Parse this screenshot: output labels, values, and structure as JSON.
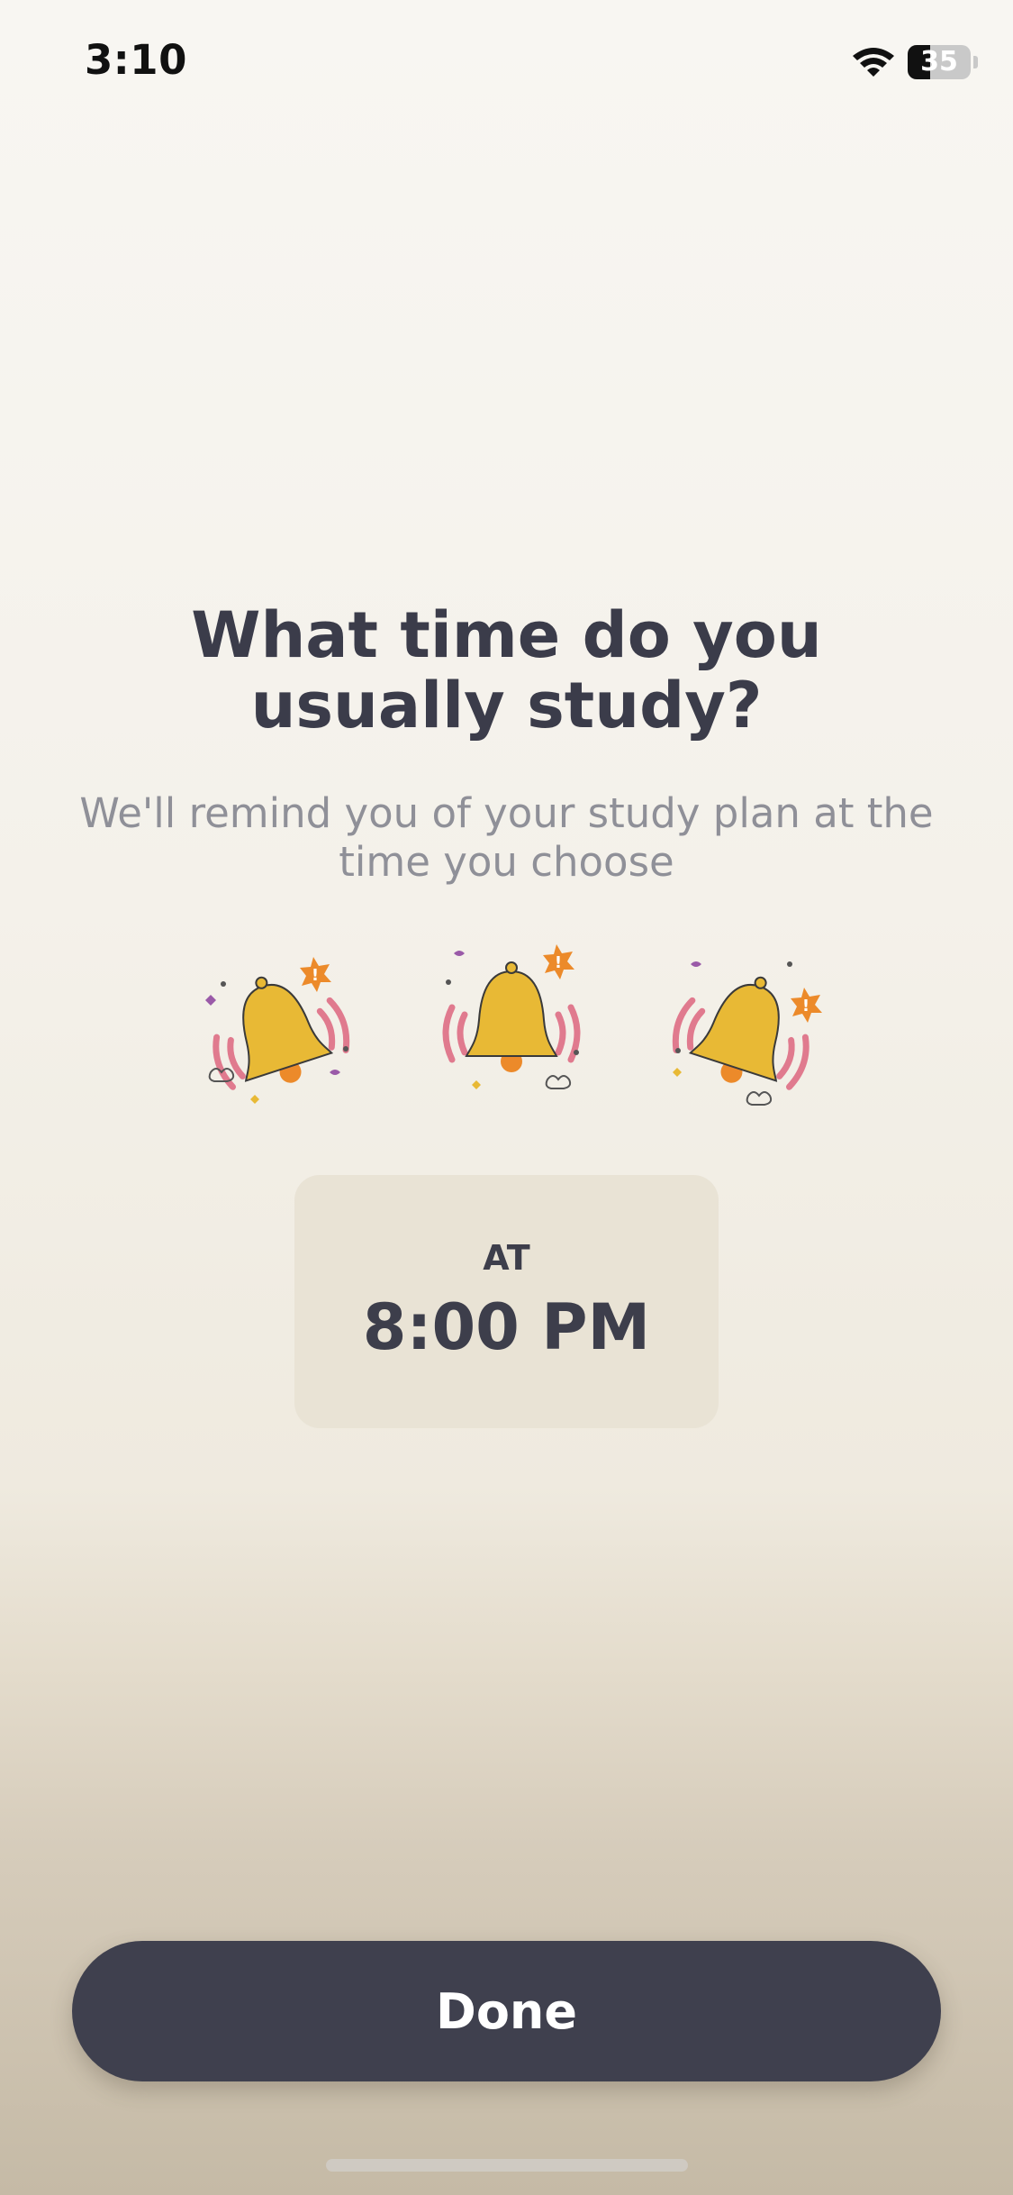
{
  "status_bar": {
    "time": "3:10",
    "battery_level": "35",
    "battery_percent": 35,
    "icons": [
      "wifi-icon",
      "battery-icon"
    ]
  },
  "title": "What time do you usually study?",
  "subtitle": "We'll remind you of your study plan at the time you choose",
  "illustrations": [
    {
      "icon": "bell-icon",
      "variant": "tilted-left"
    },
    {
      "icon": "bell-icon",
      "variant": "upright"
    },
    {
      "icon": "bell-icon",
      "variant": "tilted-right"
    }
  ],
  "reminder": {
    "prefix": "AT",
    "time": "8:00 PM"
  },
  "done_label": "Done",
  "colors": {
    "text_dark": "#3b3c4a",
    "text_muted": "#8f9098",
    "card_bg": "#e9e3d5",
    "button_bg": "#3f404e",
    "bell_yellow": "#e8b935",
    "ring_pink": "#e07a8e",
    "alert_orange": "#ec8a2a"
  }
}
